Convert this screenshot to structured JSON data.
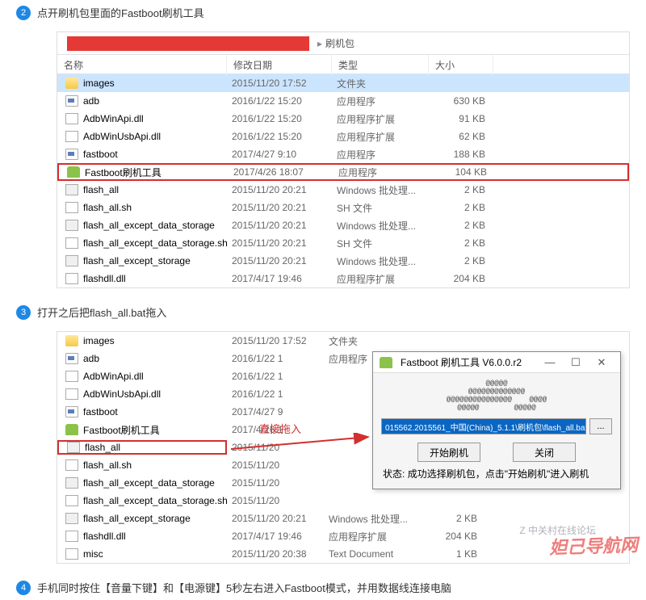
{
  "steps": {
    "s2_num": "2",
    "s2_text": "点开刷机包里面的Fastboot刷机工具",
    "s3_num": "3",
    "s3_text": "打开之后把flash_all.bat拖入",
    "s4_num": "4",
    "s4_text": "手机同时按住【音量下键】和【电源键】5秒左右进入Fastboot模式，并用数据线连接电脑"
  },
  "explorer1": {
    "breadcrumb_sep": "▸",
    "breadcrumb_last": "刷机包",
    "cols": {
      "name": "名称",
      "date": "修改日期",
      "type": "类型",
      "size": "大小"
    },
    "files": [
      {
        "icon": "folder",
        "name": "images",
        "date": "2015/11/20 17:52",
        "type": "文件夹",
        "size": "",
        "selected": true
      },
      {
        "icon": "app",
        "name": "adb",
        "date": "2016/1/22 15:20",
        "type": "应用程序",
        "size": "630 KB"
      },
      {
        "icon": "dll",
        "name": "AdbWinApi.dll",
        "date": "2016/1/22 15:20",
        "type": "应用程序扩展",
        "size": "91 KB"
      },
      {
        "icon": "dll",
        "name": "AdbWinUsbApi.dll",
        "date": "2016/1/22 15:20",
        "type": "应用程序扩展",
        "size": "62 KB"
      },
      {
        "icon": "app",
        "name": "fastboot",
        "date": "2017/4/27 9:10",
        "type": "应用程序",
        "size": "188 KB"
      },
      {
        "icon": "android",
        "name": "Fastboot刷机工具",
        "date": "2017/4/26 18:07",
        "type": "应用程序",
        "size": "104 KB",
        "highlighted": true
      },
      {
        "icon": "bat",
        "name": "flash_all",
        "date": "2015/11/20 20:21",
        "type": "Windows 批处理...",
        "size": "2 KB"
      },
      {
        "icon": "sh",
        "name": "flash_all.sh",
        "date": "2015/11/20 20:21",
        "type": "SH 文件",
        "size": "2 KB"
      },
      {
        "icon": "bat",
        "name": "flash_all_except_data_storage",
        "date": "2015/11/20 20:21",
        "type": "Windows 批处理...",
        "size": "2 KB"
      },
      {
        "icon": "sh",
        "name": "flash_all_except_data_storage.sh",
        "date": "2015/11/20 20:21",
        "type": "SH 文件",
        "size": "2 KB"
      },
      {
        "icon": "bat",
        "name": "flash_all_except_storage",
        "date": "2015/11/20 20:21",
        "type": "Windows 批处理...",
        "size": "2 KB"
      },
      {
        "icon": "dll",
        "name": "flashdll.dll",
        "date": "2017/4/17 19:46",
        "type": "应用程序扩展",
        "size": "204 KB"
      }
    ]
  },
  "explorer2": {
    "drag_label": "直接拖入",
    "files": [
      {
        "icon": "folder",
        "name": "images",
        "date": "2015/11/20 17:52",
        "type": "文件夹",
        "size": ""
      },
      {
        "icon": "app",
        "name": "adb",
        "date": "2016/1/22 1",
        "type": "应用程序",
        "size": ""
      },
      {
        "icon": "dll",
        "name": "AdbWinApi.dll",
        "date": "2016/1/22 1",
        "type": "",
        "size": ""
      },
      {
        "icon": "dll",
        "name": "AdbWinUsbApi.dll",
        "date": "2016/1/22 1",
        "type": "",
        "size": ""
      },
      {
        "icon": "app",
        "name": "fastboot",
        "date": "2017/4/27 9",
        "type": "",
        "size": ""
      },
      {
        "icon": "android",
        "name": "Fastboot刷机工具",
        "date": "2017/4/26 1",
        "type": "",
        "size": ""
      },
      {
        "icon": "bat",
        "name": "flash_all",
        "date": "2015/11/20",
        "type": "",
        "size": "",
        "boxed": true
      },
      {
        "icon": "sh",
        "name": "flash_all.sh",
        "date": "2015/11/20",
        "type": "",
        "size": ""
      },
      {
        "icon": "bat",
        "name": "flash_all_except_data_storage",
        "date": "2015/11/20",
        "type": "",
        "size": ""
      },
      {
        "icon": "sh",
        "name": "flash_all_except_data_storage.sh",
        "date": "2015/11/20",
        "type": "",
        "size": ""
      },
      {
        "icon": "bat",
        "name": "flash_all_except_storage",
        "date": "2015/11/20 20:21",
        "type": "Windows 批处理...",
        "size": "2 KB"
      },
      {
        "icon": "dll",
        "name": "flashdll.dll",
        "date": "2017/4/17 19:46",
        "type": "应用程序扩展",
        "size": "204 KB"
      },
      {
        "icon": "sh",
        "name": "misc",
        "date": "2015/11/20 20:38",
        "type": "Text Document",
        "size": "1 KB"
      }
    ]
  },
  "dialog": {
    "title": "Fastboot 刷机工具 V6.0.0.r2",
    "ascii": "@@@@@\n@@@@@@@@@@@@@\n@@@@@@@@@@@@@@@    @@@@\n@@@@@        @@@@@",
    "path": "015562.2015561_中国(China)_5.1.1\\刷机包\\flash_all.bat",
    "browse": "...",
    "btn_start": "开始刷机",
    "btn_close": "关闭",
    "status_label": "状态:",
    "status_value": "成功选择刷机包，点击\"开始刷机\"进入刷机",
    "minimize": "—",
    "maximize": "☐",
    "close": "✕"
  },
  "watermark_small": "Z 中关村在线论坛",
  "watermark_big": "妲己导航网"
}
